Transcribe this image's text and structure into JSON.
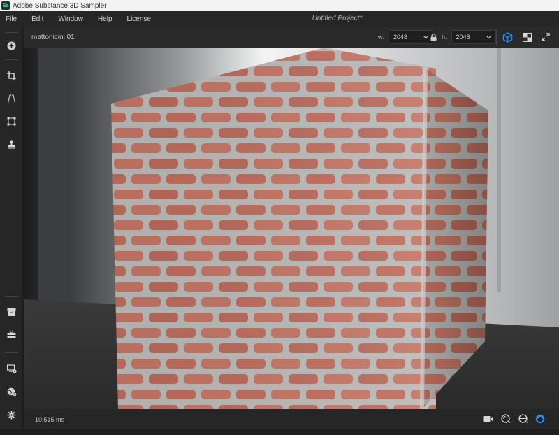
{
  "app": {
    "logo_text": "Sa",
    "title": "Adobe Substance 3D Sampler"
  },
  "menu": [
    "File",
    "Edit",
    "Window",
    "Help",
    "License"
  ],
  "project": {
    "title": "Untitled Project*"
  },
  "viewport_header": {
    "tab_name": "mattonicini 01",
    "width": {
      "label": "w:",
      "value": "2048"
    },
    "height": {
      "label": "h:",
      "value": "2048"
    }
  },
  "status": {
    "timing": "10,515 ms"
  },
  "colors": {
    "accent": "#2d8ceb",
    "panel": "#262626",
    "brick": "#b96a5a",
    "mortar": "#b4b6b4"
  },
  "sidebar_icons": [
    "add-icon",
    "crop-icon",
    "perspective-icon",
    "transform-icon",
    "stamp-icon",
    "archive-icon",
    "toolbox-icon",
    "display-settings-icon",
    "environment-icon",
    "settings-icon"
  ]
}
